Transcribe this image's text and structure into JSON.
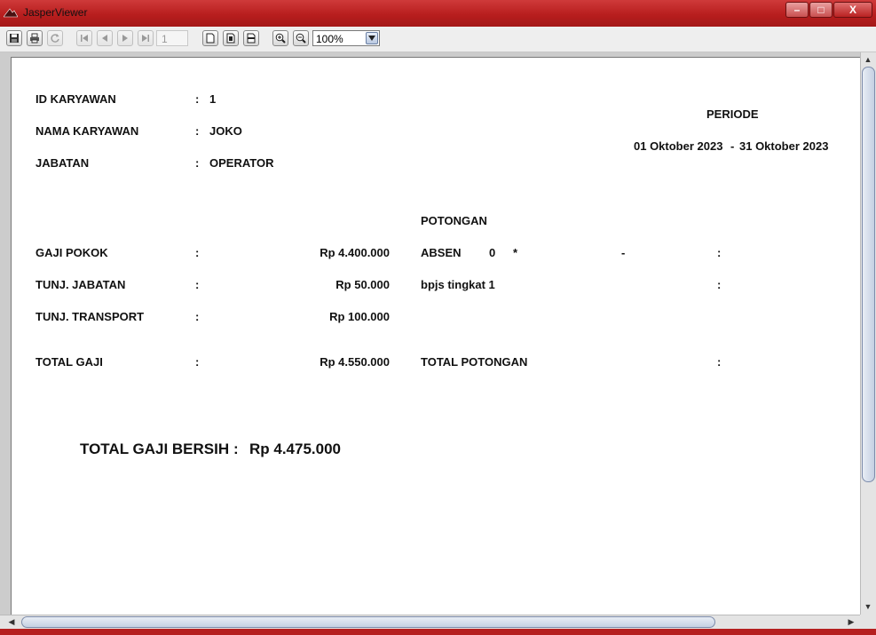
{
  "window": {
    "title": "JasperViewer",
    "minimize_label": "–",
    "maximize_label": "□",
    "close_label": "X"
  },
  "toolbar": {
    "icons": [
      "save-icon",
      "print-icon",
      "reload-icon",
      "first-page-icon",
      "previous-page-icon",
      "next-page-icon",
      "last-page-icon",
      "actual-size-icon",
      "fit-page-icon",
      "fit-width-icon",
      "zoom-in-icon",
      "zoom-out-icon"
    ],
    "page_number": "1",
    "zoom": "100%"
  },
  "report": {
    "employee": {
      "id_label": "ID KARYAWAN",
      "id_colon": ":",
      "id_value": "1",
      "name_label": "NAMA KARYAWAN",
      "name_colon": ":",
      "name_value": "JOKO",
      "position_label": "JABATAN",
      "position_colon": ":",
      "position_value": "OPERATOR"
    },
    "period": {
      "label": "PERIODE",
      "start": "01 Oktober 2023",
      "separator": "-",
      "end": "31 Oktober 2023"
    },
    "income": {
      "base_salary_label": "GAJI POKOK",
      "base_salary_colon": ":",
      "base_salary_value": "Rp 4.400.000",
      "position_allowance_label": "TUNJ. JABATAN",
      "position_allowance_colon": ":",
      "position_allowance_value": "Rp 50.000",
      "transport_allowance_label": "TUNJ. TRANSPORT",
      "transport_allowance_colon": ":",
      "transport_allowance_value": "Rp 100.000",
      "total_label": "TOTAL GAJI",
      "total_colon": ":",
      "total_value": "Rp 4.550.000"
    },
    "deductions": {
      "title": "POTONGAN",
      "absence_label": "ABSEN",
      "absence_count": "0",
      "absence_multiplier": "*",
      "absence_rate": "-",
      "absence_colon": ":",
      "bpjs_label": "bpjs tingkat 1",
      "bpjs_colon": ":",
      "total_label": "TOTAL POTONGAN",
      "total_colon": ":"
    },
    "net": {
      "label": "TOTAL GAJI BERSIH",
      "colon": ":",
      "value": "Rp 4.475.000"
    }
  },
  "colors": {
    "titlebar": "#b81e1e",
    "page_background": "#ffffff",
    "viewer_background": "#cccccc"
  }
}
